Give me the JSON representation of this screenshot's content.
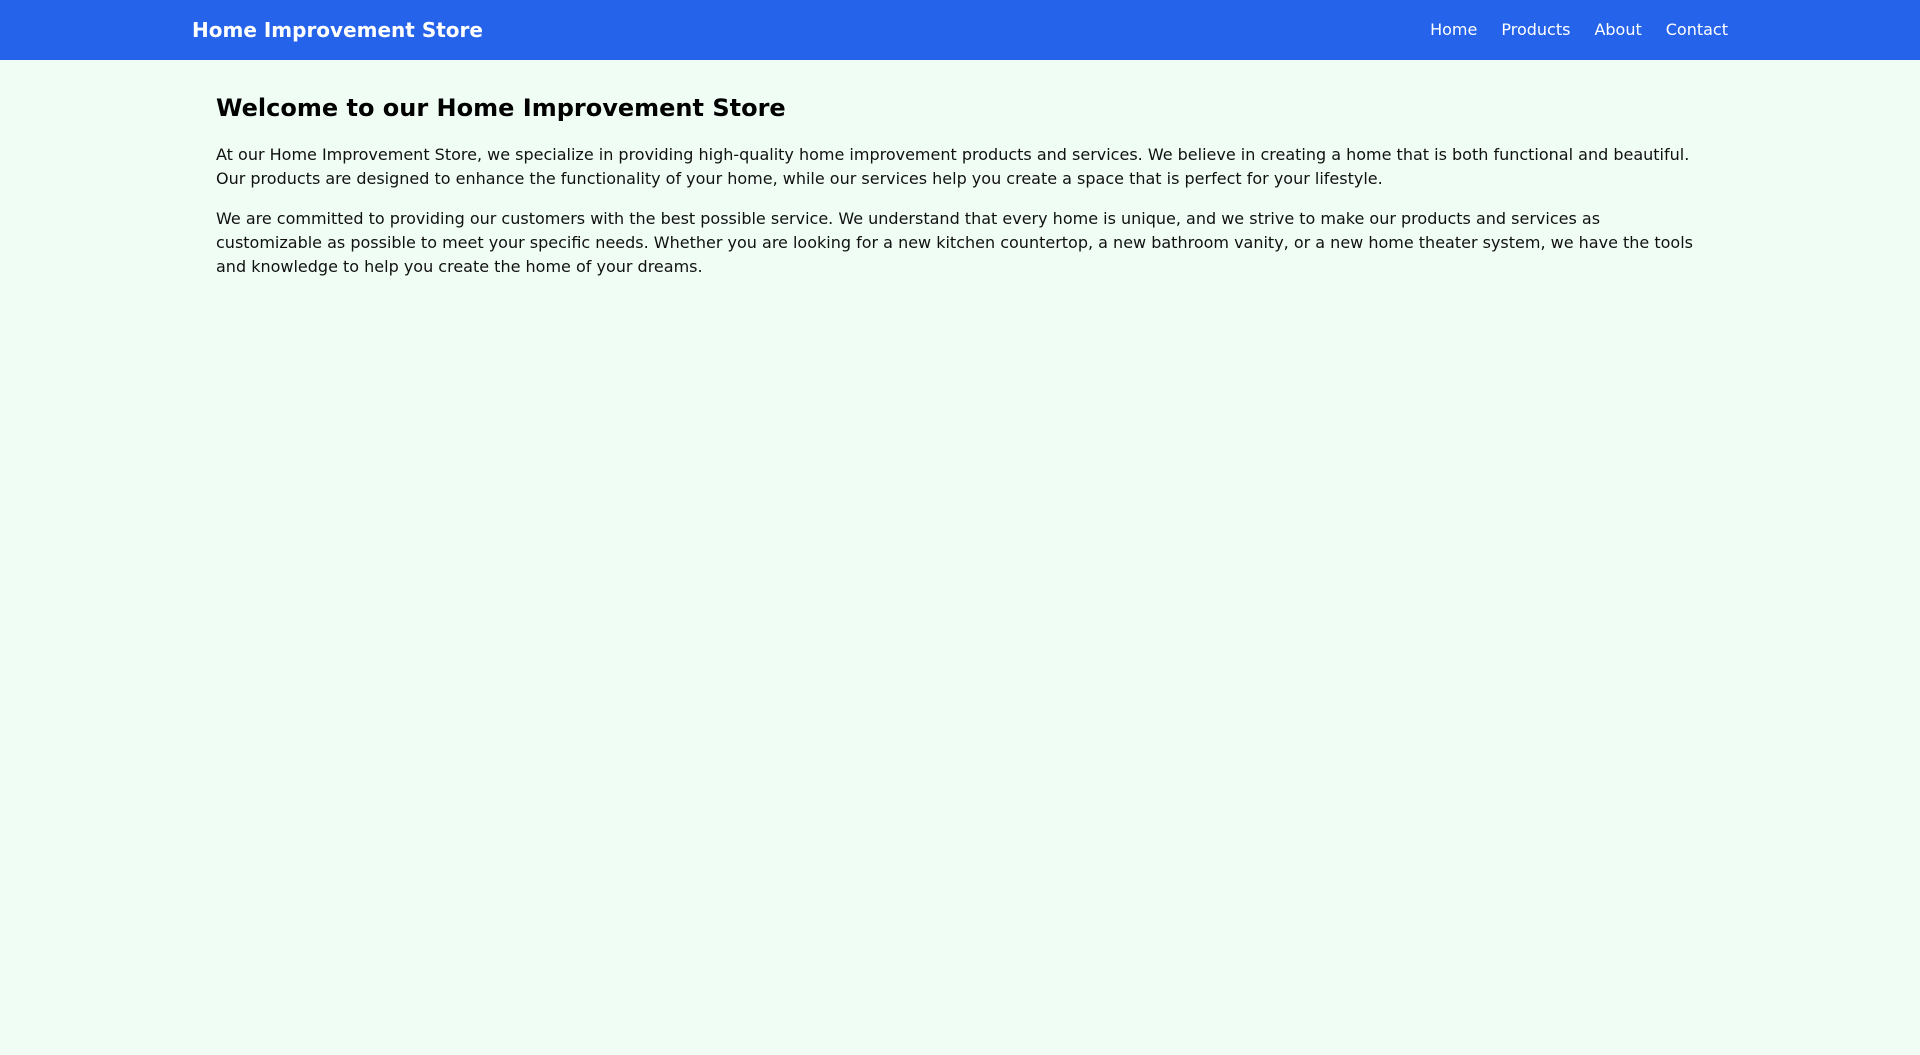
{
  "header": {
    "brand": "Home Improvement Store",
    "nav": [
      {
        "label": "Home"
      },
      {
        "label": "Products"
      },
      {
        "label": "About"
      },
      {
        "label": "Contact"
      }
    ]
  },
  "main": {
    "title": "Welcome to our Home Improvement Store",
    "paragraphs": [
      "At our Home Improvement Store, we specialize in providing high-quality home improvement products and services. We believe in creating a home that is both functional and beautiful. Our products are designed to enhance the functionality of your home, while our services help you create a space that is perfect for your lifestyle.",
      "We are committed to providing our customers with the best possible service. We understand that every home is unique, and we strive to make our products and services as customizable as possible to meet your specific needs. Whether you are looking for a new kitchen countertop, a new bathroom vanity, or a new home theater system, we have the tools and knowledge to help you create the home of your dreams."
    ]
  },
  "colors": {
    "header_bg": "#2563eb",
    "page_bg": "#effdf4",
    "header_text": "#ffffff"
  }
}
